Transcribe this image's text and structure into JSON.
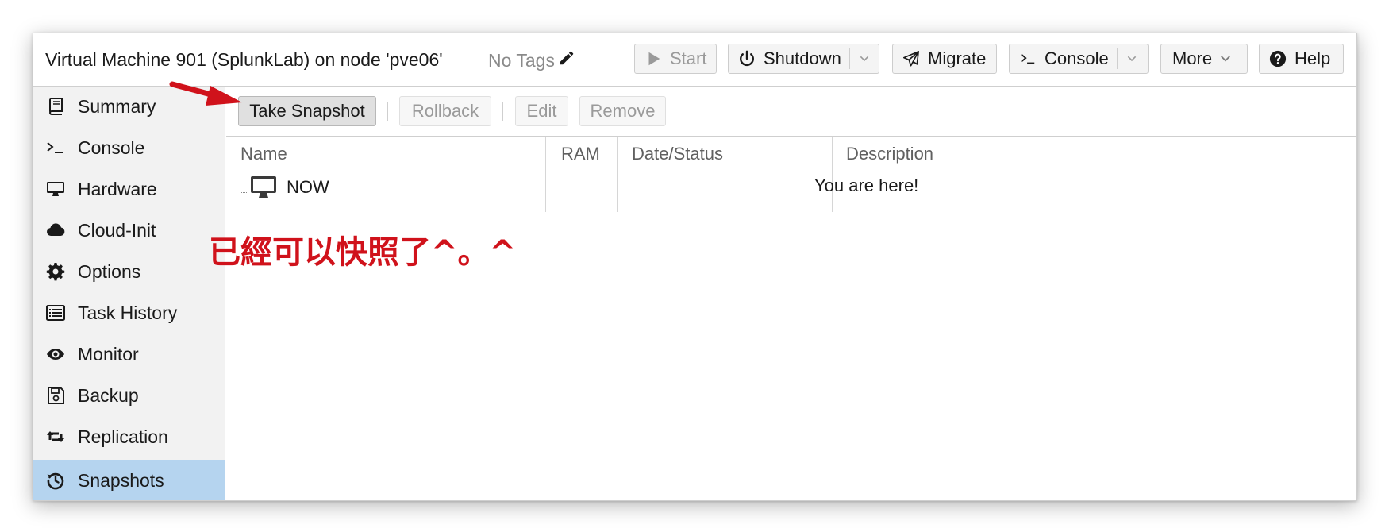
{
  "header": {
    "title": "Virtual Machine 901 (SplunkLab) on node 'pve06'",
    "tags_label": "No Tags",
    "buttons": {
      "start": "Start",
      "shutdown": "Shutdown",
      "migrate": "Migrate",
      "console": "Console",
      "more": "More",
      "help": "Help"
    }
  },
  "sidebar": {
    "items": [
      {
        "label": "Summary",
        "icon": "book-icon"
      },
      {
        "label": "Console",
        "icon": "terminal-icon"
      },
      {
        "label": "Hardware",
        "icon": "desktop-icon"
      },
      {
        "label": "Cloud-Init",
        "icon": "cloud-icon"
      },
      {
        "label": "Options",
        "icon": "gear-icon"
      },
      {
        "label": "Task History",
        "icon": "list-icon"
      },
      {
        "label": "Monitor",
        "icon": "eye-icon"
      },
      {
        "label": "Backup",
        "icon": "floppy-icon"
      },
      {
        "label": "Replication",
        "icon": "retweet-icon"
      },
      {
        "label": "Snapshots",
        "icon": "history-icon",
        "active": true
      }
    ]
  },
  "snapshots": {
    "toolbar": {
      "take_snapshot": "Take Snapshot",
      "rollback": "Rollback",
      "edit": "Edit",
      "remove": "Remove"
    },
    "columns": [
      "Name",
      "RAM",
      "Date/Status",
      "Description"
    ],
    "rows": [
      {
        "name": "NOW",
        "ram": "",
        "date_status": "",
        "description": "You are here!"
      }
    ]
  },
  "annotation": {
    "text": "已經可以快照了^。^",
    "color": "#d0121b"
  },
  "colors": {
    "active_nav": "#b5d4ef",
    "annotation_red": "#d0121b"
  }
}
